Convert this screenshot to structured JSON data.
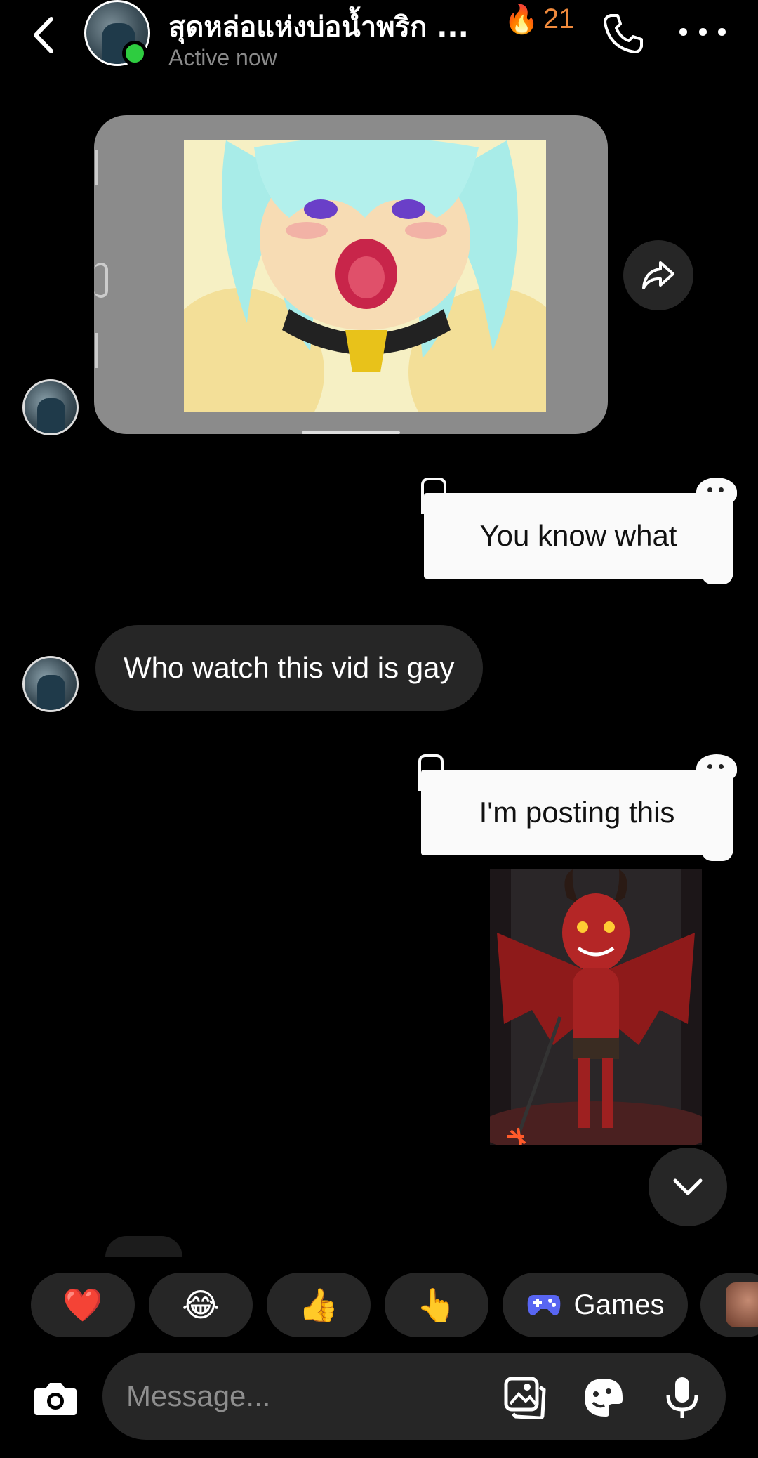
{
  "header": {
    "chat_name": "สุดหล่อแห่งบ่อน้ำพริก ...",
    "streak_emoji": "🔥",
    "streak_count": "21",
    "status": "Active now"
  },
  "messages": {
    "sent_1": "You know what",
    "received_1": "Who watch this vid is gay",
    "sent_2": "I'm posting this"
  },
  "reactions": {
    "heart": "❤️",
    "laugh": "😂",
    "thumbs_up": "👍",
    "point": "👆",
    "games_label": "Games"
  },
  "composer": {
    "placeholder": "Message..."
  },
  "colors": {
    "background": "#000000",
    "bubble_received": "#262626",
    "bubble_sent": "#fafafa",
    "online": "#2ecc40",
    "streak": "#f08a3c",
    "games_icon": "#5865f2"
  },
  "icons": [
    "back-icon",
    "phone-icon",
    "more-icon",
    "share-icon",
    "chevron-down-icon",
    "gamepad-icon",
    "camera-icon",
    "gallery-icon",
    "sticker-icon",
    "microphone-icon"
  ]
}
